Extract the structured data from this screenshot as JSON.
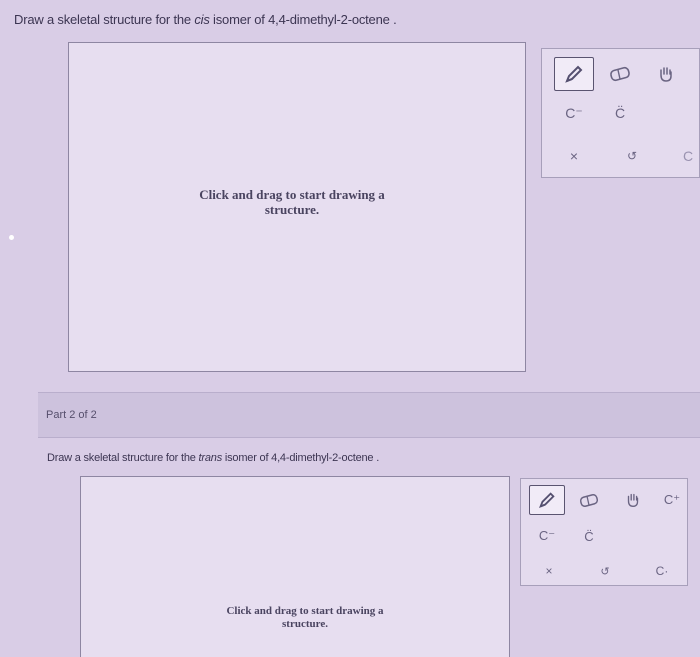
{
  "part1": {
    "question_prefix": "Draw a skeletal structure for the ",
    "question_em": "cis",
    "question_suffix": " isomer of 4,4-dimethyl-2-octene .",
    "canvas_hint_line1": "Click and drag to start drawing a",
    "canvas_hint_line2": "structure."
  },
  "part2": {
    "part_label": "Part 2 of 2",
    "question_prefix": "Draw a skeletal structure for the ",
    "question_em": "trans",
    "question_suffix": " isomer of 4,4-dimethyl-2-octene .",
    "canvas_hint_line1": "Click and drag to start drawing a",
    "canvas_hint_line2": "structure."
  },
  "toolbar1": {
    "carbanion": "C⁻",
    "carbene": "C̈",
    "delete": "×",
    "undo": "↺",
    "partial": "C"
  },
  "toolbar2": {
    "carbanion": "C⁻",
    "carbene": "C̈",
    "carbocation": "C⁺",
    "delete": "×",
    "undo": "↺",
    "radical": "C·"
  },
  "icons": {
    "pencil": "pencil-icon",
    "eraser": "eraser-icon",
    "hand": "hand-icon"
  }
}
